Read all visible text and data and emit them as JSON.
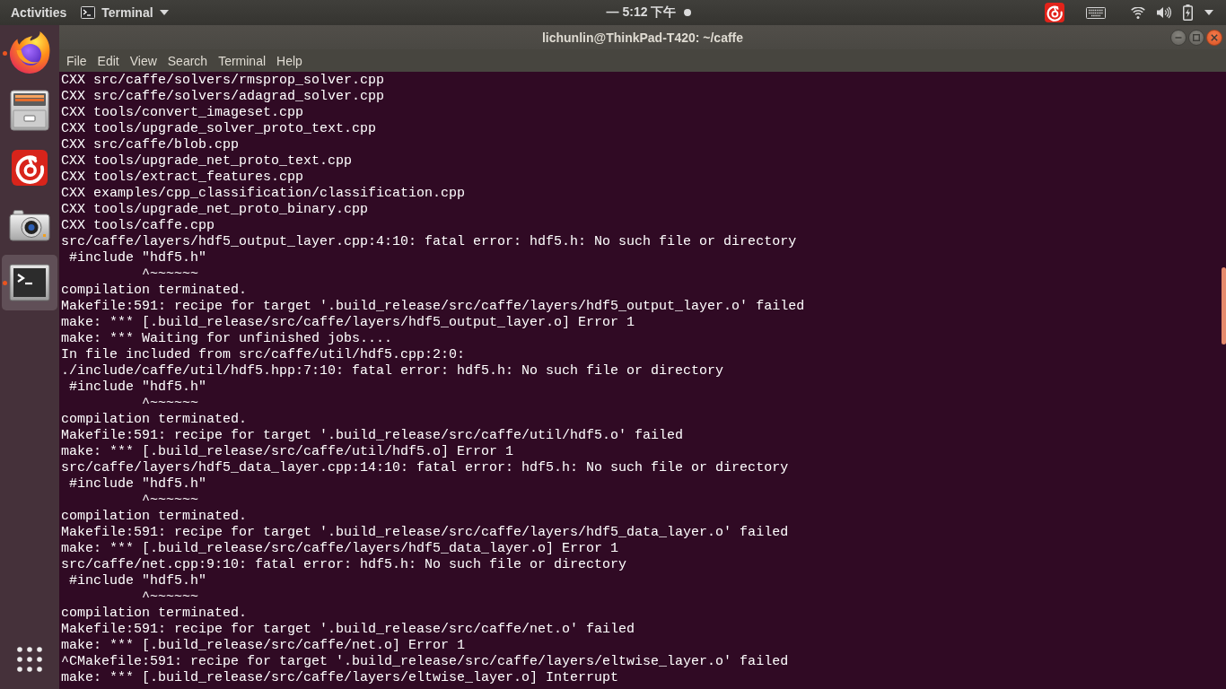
{
  "top_bar": {
    "activities": "Activities",
    "app_menu": "Terminal",
    "clock": "— 5:12 下午"
  },
  "dock": {
    "items": [
      {
        "kind": "browser",
        "running": true,
        "selected": false
      },
      {
        "kind": "files",
        "running": false,
        "selected": false
      },
      {
        "kind": "music",
        "running": false,
        "selected": false
      },
      {
        "kind": "camera",
        "running": false,
        "selected": false
      },
      {
        "kind": "terminal",
        "running": true,
        "selected": true
      }
    ]
  },
  "window": {
    "title": "lichunlin@ThinkPad-T420: ~/caffe",
    "menu": [
      "File",
      "Edit",
      "View",
      "Search",
      "Terminal",
      "Help"
    ]
  },
  "terminal": {
    "lines": [
      "CXX src/caffe/solvers/rmsprop_solver.cpp",
      "CXX src/caffe/solvers/adagrad_solver.cpp",
      "CXX tools/convert_imageset.cpp",
      "CXX tools/upgrade_solver_proto_text.cpp",
      "CXX src/caffe/blob.cpp",
      "CXX tools/upgrade_net_proto_text.cpp",
      "CXX tools/extract_features.cpp",
      "CXX examples/cpp_classification/classification.cpp",
      "CXX tools/upgrade_net_proto_binary.cpp",
      "CXX tools/caffe.cpp",
      "src/caffe/layers/hdf5_output_layer.cpp:4:10: fatal error: hdf5.h: No such file or directory",
      " #include \"hdf5.h\"",
      "          ^~~~~~~",
      "compilation terminated.",
      "Makefile:591: recipe for target '.build_release/src/caffe/layers/hdf5_output_layer.o' failed",
      "make: *** [.build_release/src/caffe/layers/hdf5_output_layer.o] Error 1",
      "make: *** Waiting for unfinished jobs....",
      "In file included from src/caffe/util/hdf5.cpp:2:0:",
      "./include/caffe/util/hdf5.hpp:7:10: fatal error: hdf5.h: No such file or directory",
      " #include \"hdf5.h\"",
      "          ^~~~~~~",
      "compilation terminated.",
      "Makefile:591: recipe for target '.build_release/src/caffe/util/hdf5.o' failed",
      "make: *** [.build_release/src/caffe/util/hdf5.o] Error 1",
      "src/caffe/layers/hdf5_data_layer.cpp:14:10: fatal error: hdf5.h: No such file or directory",
      " #include \"hdf5.h\"",
      "          ^~~~~~~",
      "compilation terminated.",
      "Makefile:591: recipe for target '.build_release/src/caffe/layers/hdf5_data_layer.o' failed",
      "make: *** [.build_release/src/caffe/layers/hdf5_data_layer.o] Error 1",
      "src/caffe/net.cpp:9:10: fatal error: hdf5.h: No such file or directory",
      " #include \"hdf5.h\"",
      "          ^~~~~~~",
      "compilation terminated.",
      "Makefile:591: recipe for target '.build_release/src/caffe/net.o' failed",
      "make: *** [.build_release/src/caffe/net.o] Error 1",
      "^CMakefile:591: recipe for target '.build_release/src/caffe/layers/eltwise_layer.o' failed",
      "make: *** [.build_release/src/caffe/layers/eltwise_layer.o] Interrupt"
    ]
  }
}
